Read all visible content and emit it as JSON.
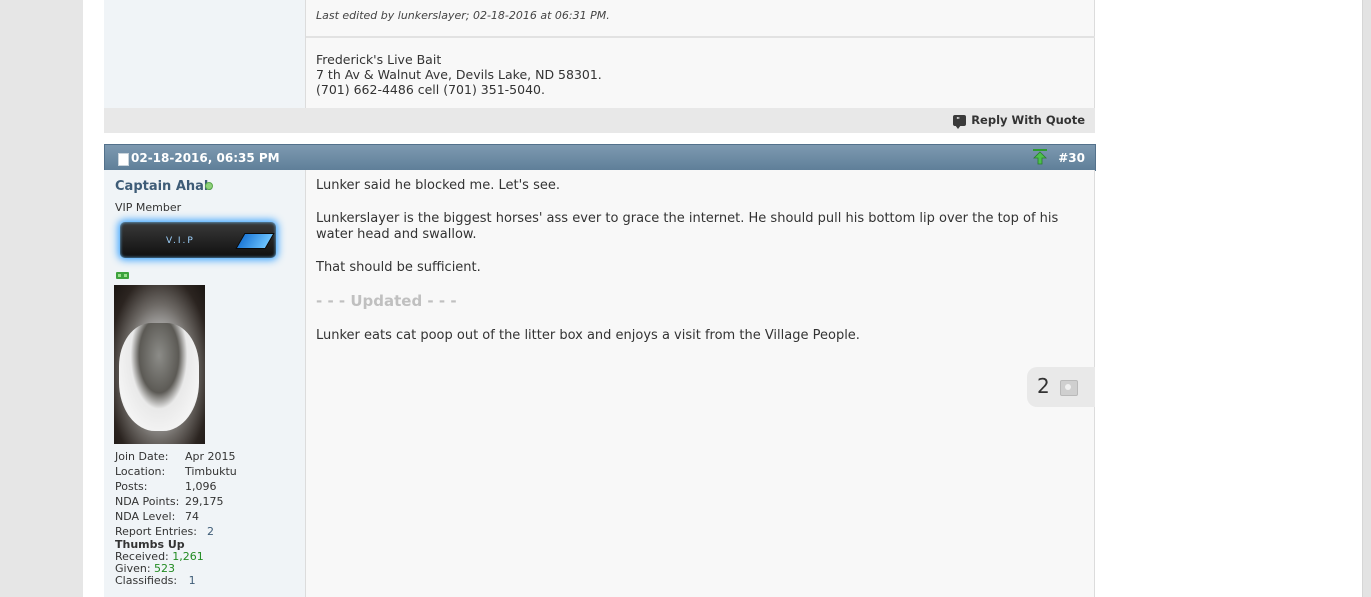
{
  "previous_post": {
    "edited_note": "Last edited by lunkerslayer; 02-18-2016 at 06:31 PM.",
    "signature": [
      "Frederick's Live Bait",
      "7 th Av & Walnut Ave, Devils Lake, ND 58301.",
      "(701) 662-4486 cell (701) 351-5040."
    ],
    "reply_with_quote": "Reply With Quote"
  },
  "post": {
    "date": "02-18-2016, 06:35 PM",
    "number": "#30",
    "user": {
      "name": "Captain Ahab",
      "title": "VIP Member",
      "badge_text": "V.I.P",
      "join_date_label": "Join Date:",
      "join_date": "Apr 2015",
      "location_label": "Location:",
      "location": "Timbuktu",
      "posts_label": "Posts:",
      "posts": "1,096",
      "nda_points_label": "NDA Points:",
      "nda_points": "29,175",
      "nda_level_label": "NDA Level:",
      "nda_level": "74",
      "report_entries_label": "Report Entries:",
      "report_entries": "2",
      "thumbs_up_label": "Thumbs Up",
      "received_label": "Received:",
      "received": "1,261",
      "given_label": "Given:",
      "given": "523",
      "classifieds_label": "Classifieds:",
      "classifieds": "1"
    },
    "message": [
      "Lunker said he blocked me. Let's see.",
      "Lunkerslayer is the biggest horses' ass ever to grace the internet. He should pull his bottom lip over the top of his water head and swallow.",
      "That should be sufficient."
    ],
    "updated_separator": "- - - Updated - - -",
    "message_after": "Lunker eats cat poop out of the litter box and enjoys a visit from the Village People.",
    "like_count": "2"
  },
  "colors": {
    "header": "#6f8ca5",
    "username": "#3e5c77",
    "green": "#228b22"
  }
}
